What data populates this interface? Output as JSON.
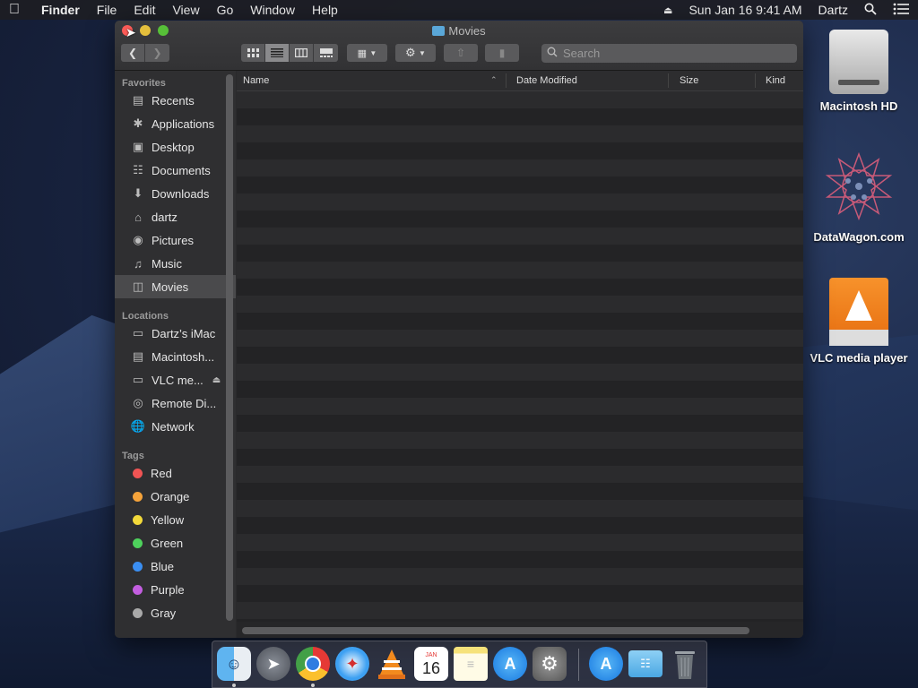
{
  "menubar": {
    "app": "Finder",
    "items": [
      "File",
      "Edit",
      "View",
      "Go",
      "Window",
      "Help"
    ],
    "datetime": "Sun Jan 16  9:41 AM",
    "user": "Dartz"
  },
  "window": {
    "title": "Movies",
    "search_placeholder": "Search",
    "columns": {
      "name": "Name",
      "date": "Date Modified",
      "size": "Size",
      "kind": "Kind"
    }
  },
  "sidebar": {
    "favorites_label": "Favorites",
    "favorites": [
      {
        "label": "Recents",
        "icon": "recents-icon"
      },
      {
        "label": "Applications",
        "icon": "applications-icon"
      },
      {
        "label": "Desktop",
        "icon": "desktop-icon"
      },
      {
        "label": "Documents",
        "icon": "documents-icon"
      },
      {
        "label": "Downloads",
        "icon": "downloads-icon"
      },
      {
        "label": "dartz",
        "icon": "home-icon"
      },
      {
        "label": "Pictures",
        "icon": "pictures-icon"
      },
      {
        "label": "Music",
        "icon": "music-icon"
      },
      {
        "label": "Movies",
        "icon": "movies-icon"
      }
    ],
    "locations_label": "Locations",
    "locations": [
      {
        "label": "Dartz’s iMac"
      },
      {
        "label": "Macintosh..."
      },
      {
        "label": "VLC me..."
      },
      {
        "label": "Remote Di..."
      },
      {
        "label": "Network"
      }
    ],
    "tags_label": "Tags",
    "tags": [
      {
        "label": "Red",
        "color": "#f05454"
      },
      {
        "label": "Orange",
        "color": "#f5a33a"
      },
      {
        "label": "Yellow",
        "color": "#f2d93a"
      },
      {
        "label": "Green",
        "color": "#4ed15c"
      },
      {
        "label": "Blue",
        "color": "#3a8ef2"
      },
      {
        "label": "Purple",
        "color": "#c35ee0"
      },
      {
        "label": "Gray",
        "color": "#a9a9a9"
      }
    ]
  },
  "desktop": {
    "icons": [
      {
        "label": "Macintosh HD"
      },
      {
        "label": "DataWagon.com"
      },
      {
        "label": "VLC media player"
      }
    ]
  },
  "dock": {
    "calendar_month": "JAN",
    "calendar_day": "16"
  }
}
